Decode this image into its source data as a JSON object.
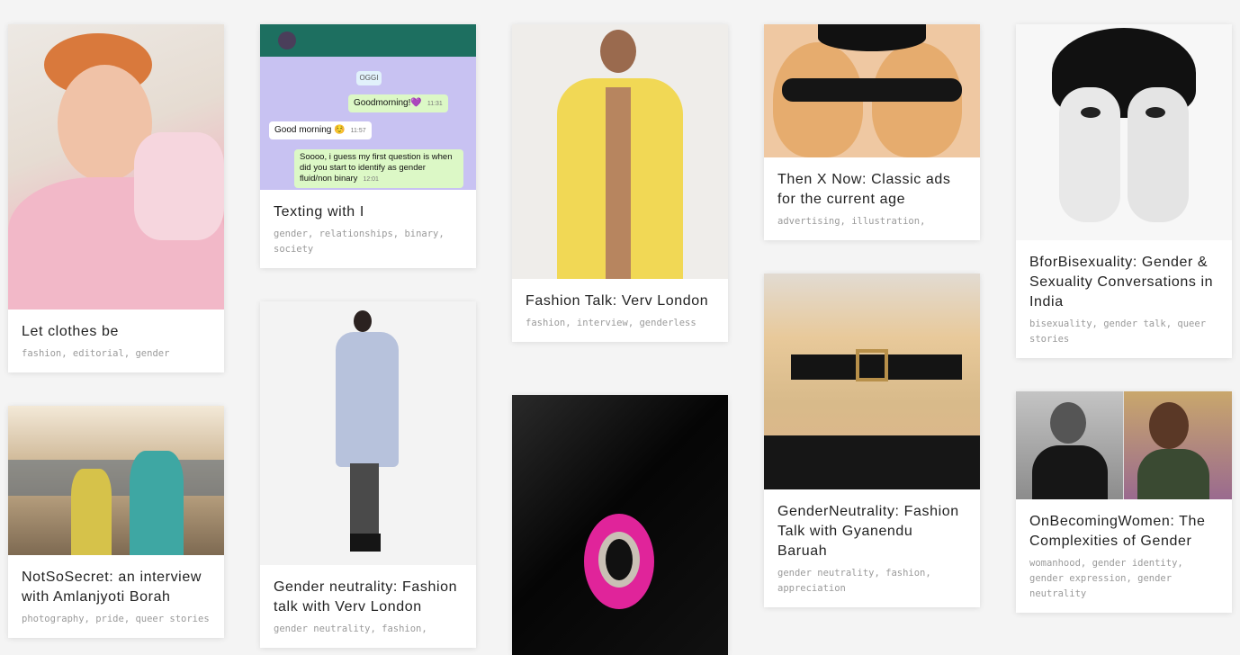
{
  "posts": [
    {
      "title": "Let clothes be",
      "tags": [
        "fashion",
        "editorial",
        "gender"
      ]
    },
    {
      "title": "NotSoSecret: an interview with Amlanjyoti Borah",
      "tags": [
        "photography",
        "pride",
        "queer stories"
      ]
    },
    {
      "title": "Texting with I",
      "tags": [
        "gender",
        "relationships",
        "binary",
        "society"
      ],
      "chat": {
        "day": "OGGI",
        "msg1": "Goodmorning!💜",
        "time1": "11:31",
        "msg2": "Good morning ☺️",
        "time2": "11:57",
        "msg3": "Soooo, i guess my first question is when did you start to identify as gender fluid/non binary",
        "time3": "12:01"
      }
    },
    {
      "title": "Gender neutrality: Fashion talk with Verv London",
      "tags": [
        "gender neutrality",
        "fashion"
      ]
    },
    {
      "title": "Fashion Talk: Verv London",
      "tags": [
        "fashion",
        "interview",
        "genderless"
      ]
    },
    {
      "title": "",
      "tags": []
    },
    {
      "title": "Then X Now: Classic ads for the current age",
      "tags": [
        "advertising",
        "illustration"
      ]
    },
    {
      "title": "GenderNeutrality: Fashion Talk with Gyanendu Baruah",
      "tags": [
        "gender neutrality",
        "fashion",
        "appreciation"
      ]
    },
    {
      "title": "BforBisexuality: Gender & Sexuality Conversations in India",
      "tags": [
        "bisexuality",
        "gender talk",
        "queer stories"
      ]
    },
    {
      "title": "OnBecomingWomen: The Complexities of Gender",
      "tags": [
        "womanhood",
        "gender identity",
        "gender expression",
        "gender neutrality"
      ]
    }
  ]
}
